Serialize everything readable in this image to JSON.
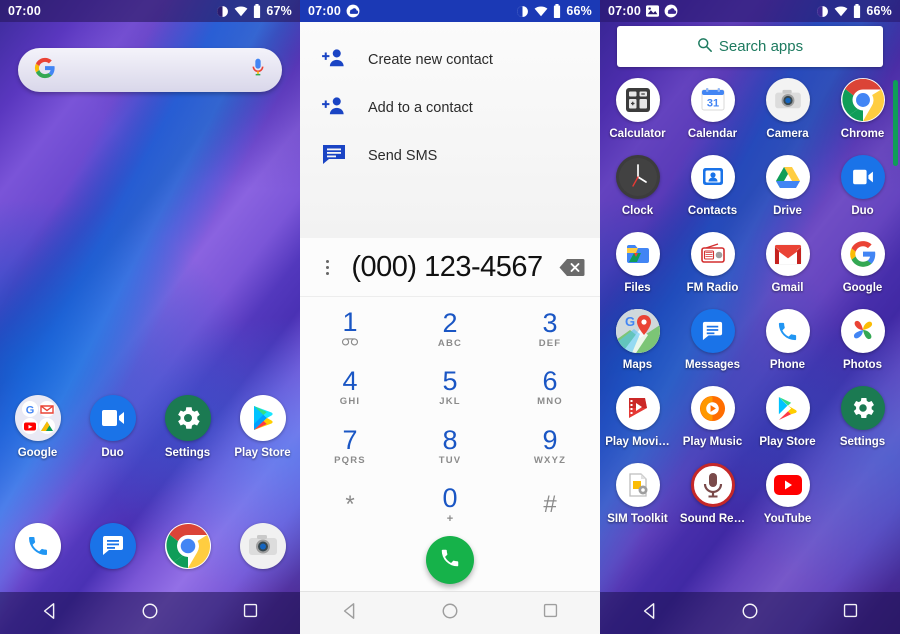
{
  "panels": {
    "home": {
      "status": {
        "time": "07:00",
        "battery": "67%",
        "icons": [
          "dnd-icon",
          "wifi-icon",
          "battery-icon"
        ]
      },
      "search": {
        "logo": "google-g-icon",
        "mic": "microphone-icon",
        "placeholder": ""
      },
      "row1": [
        {
          "label": "Google",
          "icon": "google-folder-icon"
        },
        {
          "label": "Duo",
          "icon": "duo-icon"
        },
        {
          "label": "Settings",
          "icon": "settings-icon"
        },
        {
          "label": "Play Store",
          "icon": "play-store-icon"
        }
      ],
      "dock": [
        {
          "label": "",
          "icon": "phone-icon"
        },
        {
          "label": "",
          "icon": "messages-icon"
        },
        {
          "label": "",
          "icon": "chrome-icon"
        },
        {
          "label": "",
          "icon": "camera-icon"
        }
      ],
      "nav": [
        "back-icon",
        "home-icon",
        "recents-icon"
      ]
    },
    "dialer": {
      "status": {
        "time": "07:00",
        "battery": "66%",
        "icons": [
          "cloud-sync-icon",
          "dnd-icon",
          "wifi-icon",
          "battery-icon"
        ]
      },
      "menu": [
        {
          "label": "Create new contact",
          "icon": "add-contact-icon"
        },
        {
          "label": "Add to a contact",
          "icon": "add-contact-icon"
        },
        {
          "label": "Send SMS",
          "icon": "message-icon"
        }
      ],
      "number": "(000) 123-4567",
      "overflow_icon": "kebab-menu-icon",
      "backspace_icon": "backspace-icon",
      "keys": [
        {
          "digit": "1",
          "sub": "⌕",
          "sub_kind": "voicemail"
        },
        {
          "digit": "2",
          "sub": "ABC",
          "sub_kind": "letters"
        },
        {
          "digit": "3",
          "sub": "DEF",
          "sub_kind": "letters"
        },
        {
          "digit": "4",
          "sub": "GHI",
          "sub_kind": "letters"
        },
        {
          "digit": "5",
          "sub": "JKL",
          "sub_kind": "letters"
        },
        {
          "digit": "6",
          "sub": "MNO",
          "sub_kind": "letters"
        },
        {
          "digit": "7",
          "sub": "PQRS",
          "sub_kind": "letters"
        },
        {
          "digit": "8",
          "sub": "TUV",
          "sub_kind": "letters"
        },
        {
          "digit": "9",
          "sub": "WXYZ",
          "sub_kind": "letters"
        },
        {
          "digit": "*",
          "sub": "",
          "sub_kind": "none"
        },
        {
          "digit": "0",
          "sub": "+",
          "sub_kind": "plus"
        },
        {
          "digit": "#",
          "sub": "",
          "sub_kind": "none"
        }
      ],
      "call_button": {
        "icon": "call-icon",
        "color": "#16b24a"
      },
      "nav": [
        "back-icon",
        "home-icon",
        "recents-icon"
      ]
    },
    "drawer": {
      "status": {
        "time": "07:00",
        "battery": "66%",
        "icons": [
          "image-icon",
          "cloud-sync-icon",
          "dnd-icon",
          "wifi-icon",
          "battery-icon"
        ]
      },
      "search": {
        "label": "Search apps",
        "icon": "search-icon",
        "color": "#1d7a5f"
      },
      "apps": [
        {
          "label": "Calculator",
          "icon": "calculator-icon"
        },
        {
          "label": "Calendar",
          "icon": "calendar-icon"
        },
        {
          "label": "Camera",
          "icon": "camera-icon"
        },
        {
          "label": "Chrome",
          "icon": "chrome-icon"
        },
        {
          "label": "Clock",
          "icon": "clock-icon"
        },
        {
          "label": "Contacts",
          "icon": "contacts-icon"
        },
        {
          "label": "Drive",
          "icon": "drive-icon"
        },
        {
          "label": "Duo",
          "icon": "duo-icon"
        },
        {
          "label": "Files",
          "icon": "files-icon"
        },
        {
          "label": "FM Radio",
          "icon": "fm-radio-icon"
        },
        {
          "label": "Gmail",
          "icon": "gmail-icon"
        },
        {
          "label": "Google",
          "icon": "google-icon"
        },
        {
          "label": "Maps",
          "icon": "maps-icon"
        },
        {
          "label": "Messages",
          "icon": "messages-icon"
        },
        {
          "label": "Phone",
          "icon": "phone-icon"
        },
        {
          "label": "Photos",
          "icon": "photos-icon"
        },
        {
          "label": "Play Movi…",
          "icon": "play-movies-icon"
        },
        {
          "label": "Play Music",
          "icon": "play-music-icon"
        },
        {
          "label": "Play Store",
          "icon": "play-store-icon"
        },
        {
          "label": "Settings",
          "icon": "settings-icon"
        },
        {
          "label": "SIM Toolkit",
          "icon": "sim-toolkit-icon"
        },
        {
          "label": "Sound Re…",
          "icon": "sound-recorder-icon"
        },
        {
          "label": "YouTube",
          "icon": "youtube-icon"
        }
      ],
      "scrollbar_color": "#0f9d58",
      "nav": [
        "back-icon",
        "home-icon",
        "recents-icon"
      ]
    }
  }
}
